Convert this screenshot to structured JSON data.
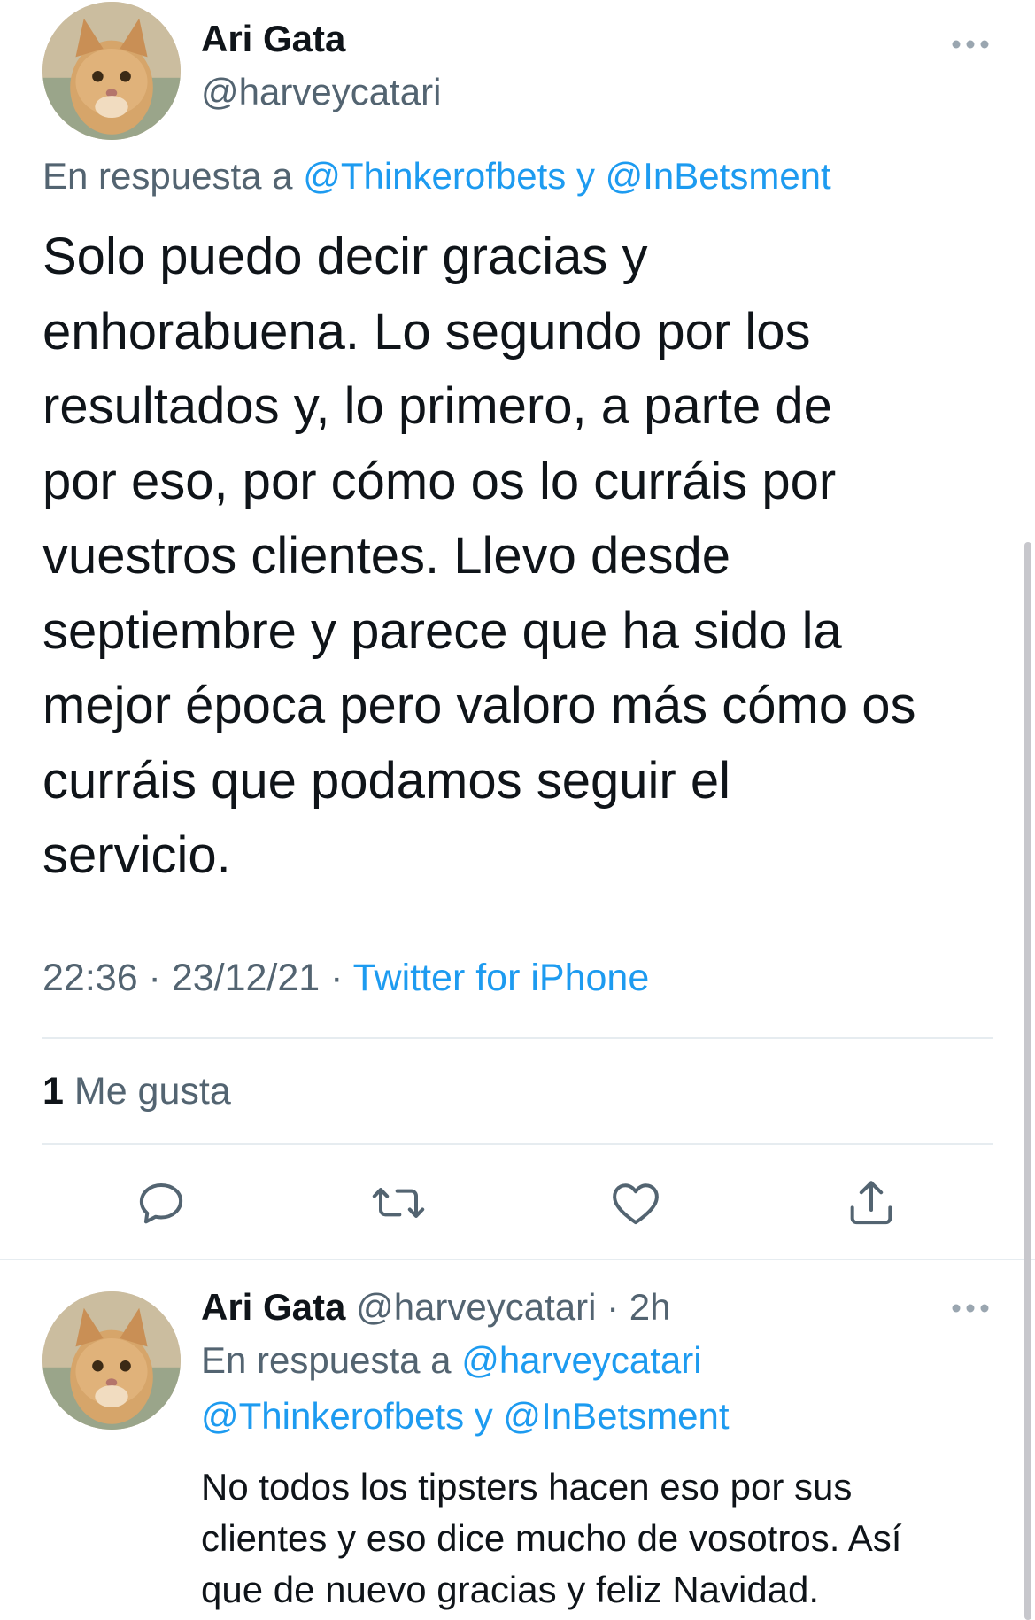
{
  "main_tweet": {
    "author_name": "Ari Gata",
    "author_handle": "@harveycatari",
    "reply_prefix": "En respuesta a ",
    "reply_mentions": "@Thinkerofbets y @InBetsment",
    "text": "Solo puedo decir gracias y\nenhorabuena. Lo segundo por los\nresultados y, lo primero, a parte de\npor eso, por cómo os lo curráis por\nvuestros clientes. Llevo desde\nseptiembre y parece que ha sido la\nmejor época pero valoro más cómo os\ncurráis que podamos seguir el\nservicio.",
    "time": "22:36",
    "date": "23/12/21",
    "separator": " · ",
    "source": "Twitter for iPhone",
    "likes_count": "1",
    "likes_label": " Me gusta"
  },
  "reply_tweet": {
    "author_name": "Ari Gata",
    "author_handle": "@harveycatari",
    "age": "2h",
    "separator": " · ",
    "reply_prefix": "En respuesta a ",
    "reply_mention_1": "@harveycatari",
    "reply_mentions_2": "@Thinkerofbets y @InBetsment",
    "text": "No todos los tipsters hacen eso por sus\nclientes y eso dice mucho de vosotros. Así\nque de nuevo gracias y feliz Navidad."
  },
  "icons": {
    "reply": "reply-icon",
    "retweet": "retweet-icon",
    "like": "heart-icon",
    "share": "share-icon",
    "more": "more-icon"
  },
  "colors": {
    "accent": "#1d9bf0",
    "secondary_text": "#536471",
    "primary_text": "#0f1419"
  }
}
